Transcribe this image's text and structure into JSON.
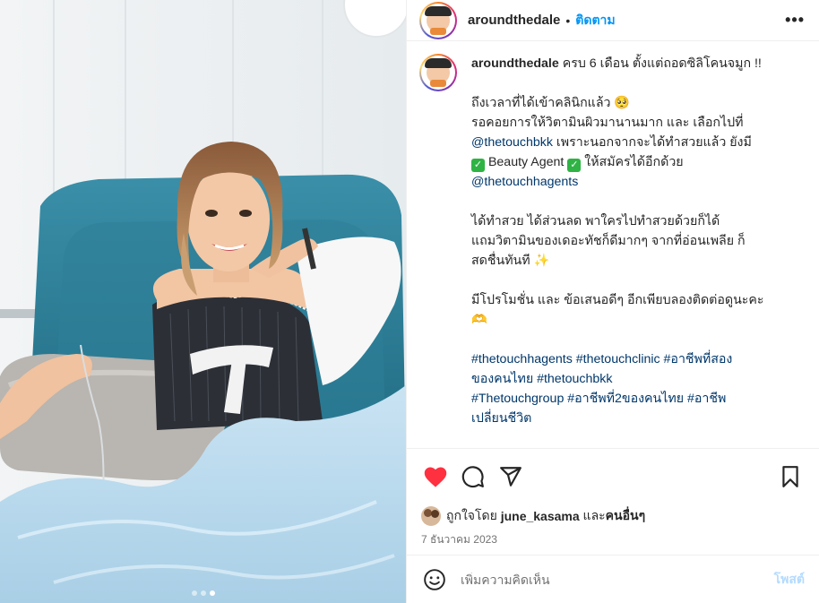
{
  "post": {
    "username": "aroundthedale",
    "separator": "•",
    "follow_label": "ติดตาม",
    "more_label": "•••"
  },
  "caption": {
    "username": "aroundthedale",
    "line1": "ครบ 6 เดือน ตั้งแต่ถอดซิลิโคนจมูก !!",
    "p2_l1": "ถึงเวลาที่ได้เข้าคลินิกแล้ว 🥺",
    "p2_l2": "รอคอยการให้วิตามินผิวมานานมาก และ เลือกไปที่",
    "p2_link1": "@thetouchbkk",
    "p2_l3": "เพราะนอกจากจะได้ทำสวยแล้ว ยังมี",
    "check": "✓",
    "beauty_agent": "Beauty Agent",
    "p2_l4": "ให้สมัครได้อีกด้วย",
    "p2_link2": "@thetouchhagents",
    "p3_l1": "ได้ทำสวย ได้ส่วนลด พาใครไปทำสวยด้วยก็ได้",
    "p3_l2": "แถมวิตามินของเดอะทัชก็ดีมากๆ จากที่อ่อนเพลีย ก็",
    "p3_l3": "สดชื่นทันที ✨",
    "p4_l1": "มีโปรโมชั่น และ ข้อเสนอดีๆ อีกเพียบลองติดต่อดูนะคะ",
    "p4_l2": "🫶",
    "tags_l1": "#thetouchhagents #thetouchclinic #อาชีพที่สอง",
    "tags_l2": "ของคนไทย #thetouchbkk",
    "tags_l3": "#Thetouchgroup #อาชีพที่2ของคนไทย #อาชีพ",
    "tags_l4": "เปลี่ยนชีวิต"
  },
  "likes": {
    "prefix": "ถูกใจโดย",
    "user": "june_kasama",
    "and": "และ",
    "others": "คนอื่นๆ"
  },
  "date": "7 ธันวาคม 2023",
  "comment": {
    "placeholder": "เพิ่มความคิดเห็น",
    "post_label": "โพสต์"
  },
  "colors": {
    "like_heart": "#ff3040",
    "link": "#00376b",
    "follow": "#0095f6",
    "post_disabled": "#b3dbff"
  },
  "icons": [
    "heart-icon",
    "comment-icon",
    "share-icon",
    "bookmark-icon",
    "emoji-icon",
    "more-icon"
  ],
  "carousel": {
    "total": 3,
    "active": 3
  }
}
